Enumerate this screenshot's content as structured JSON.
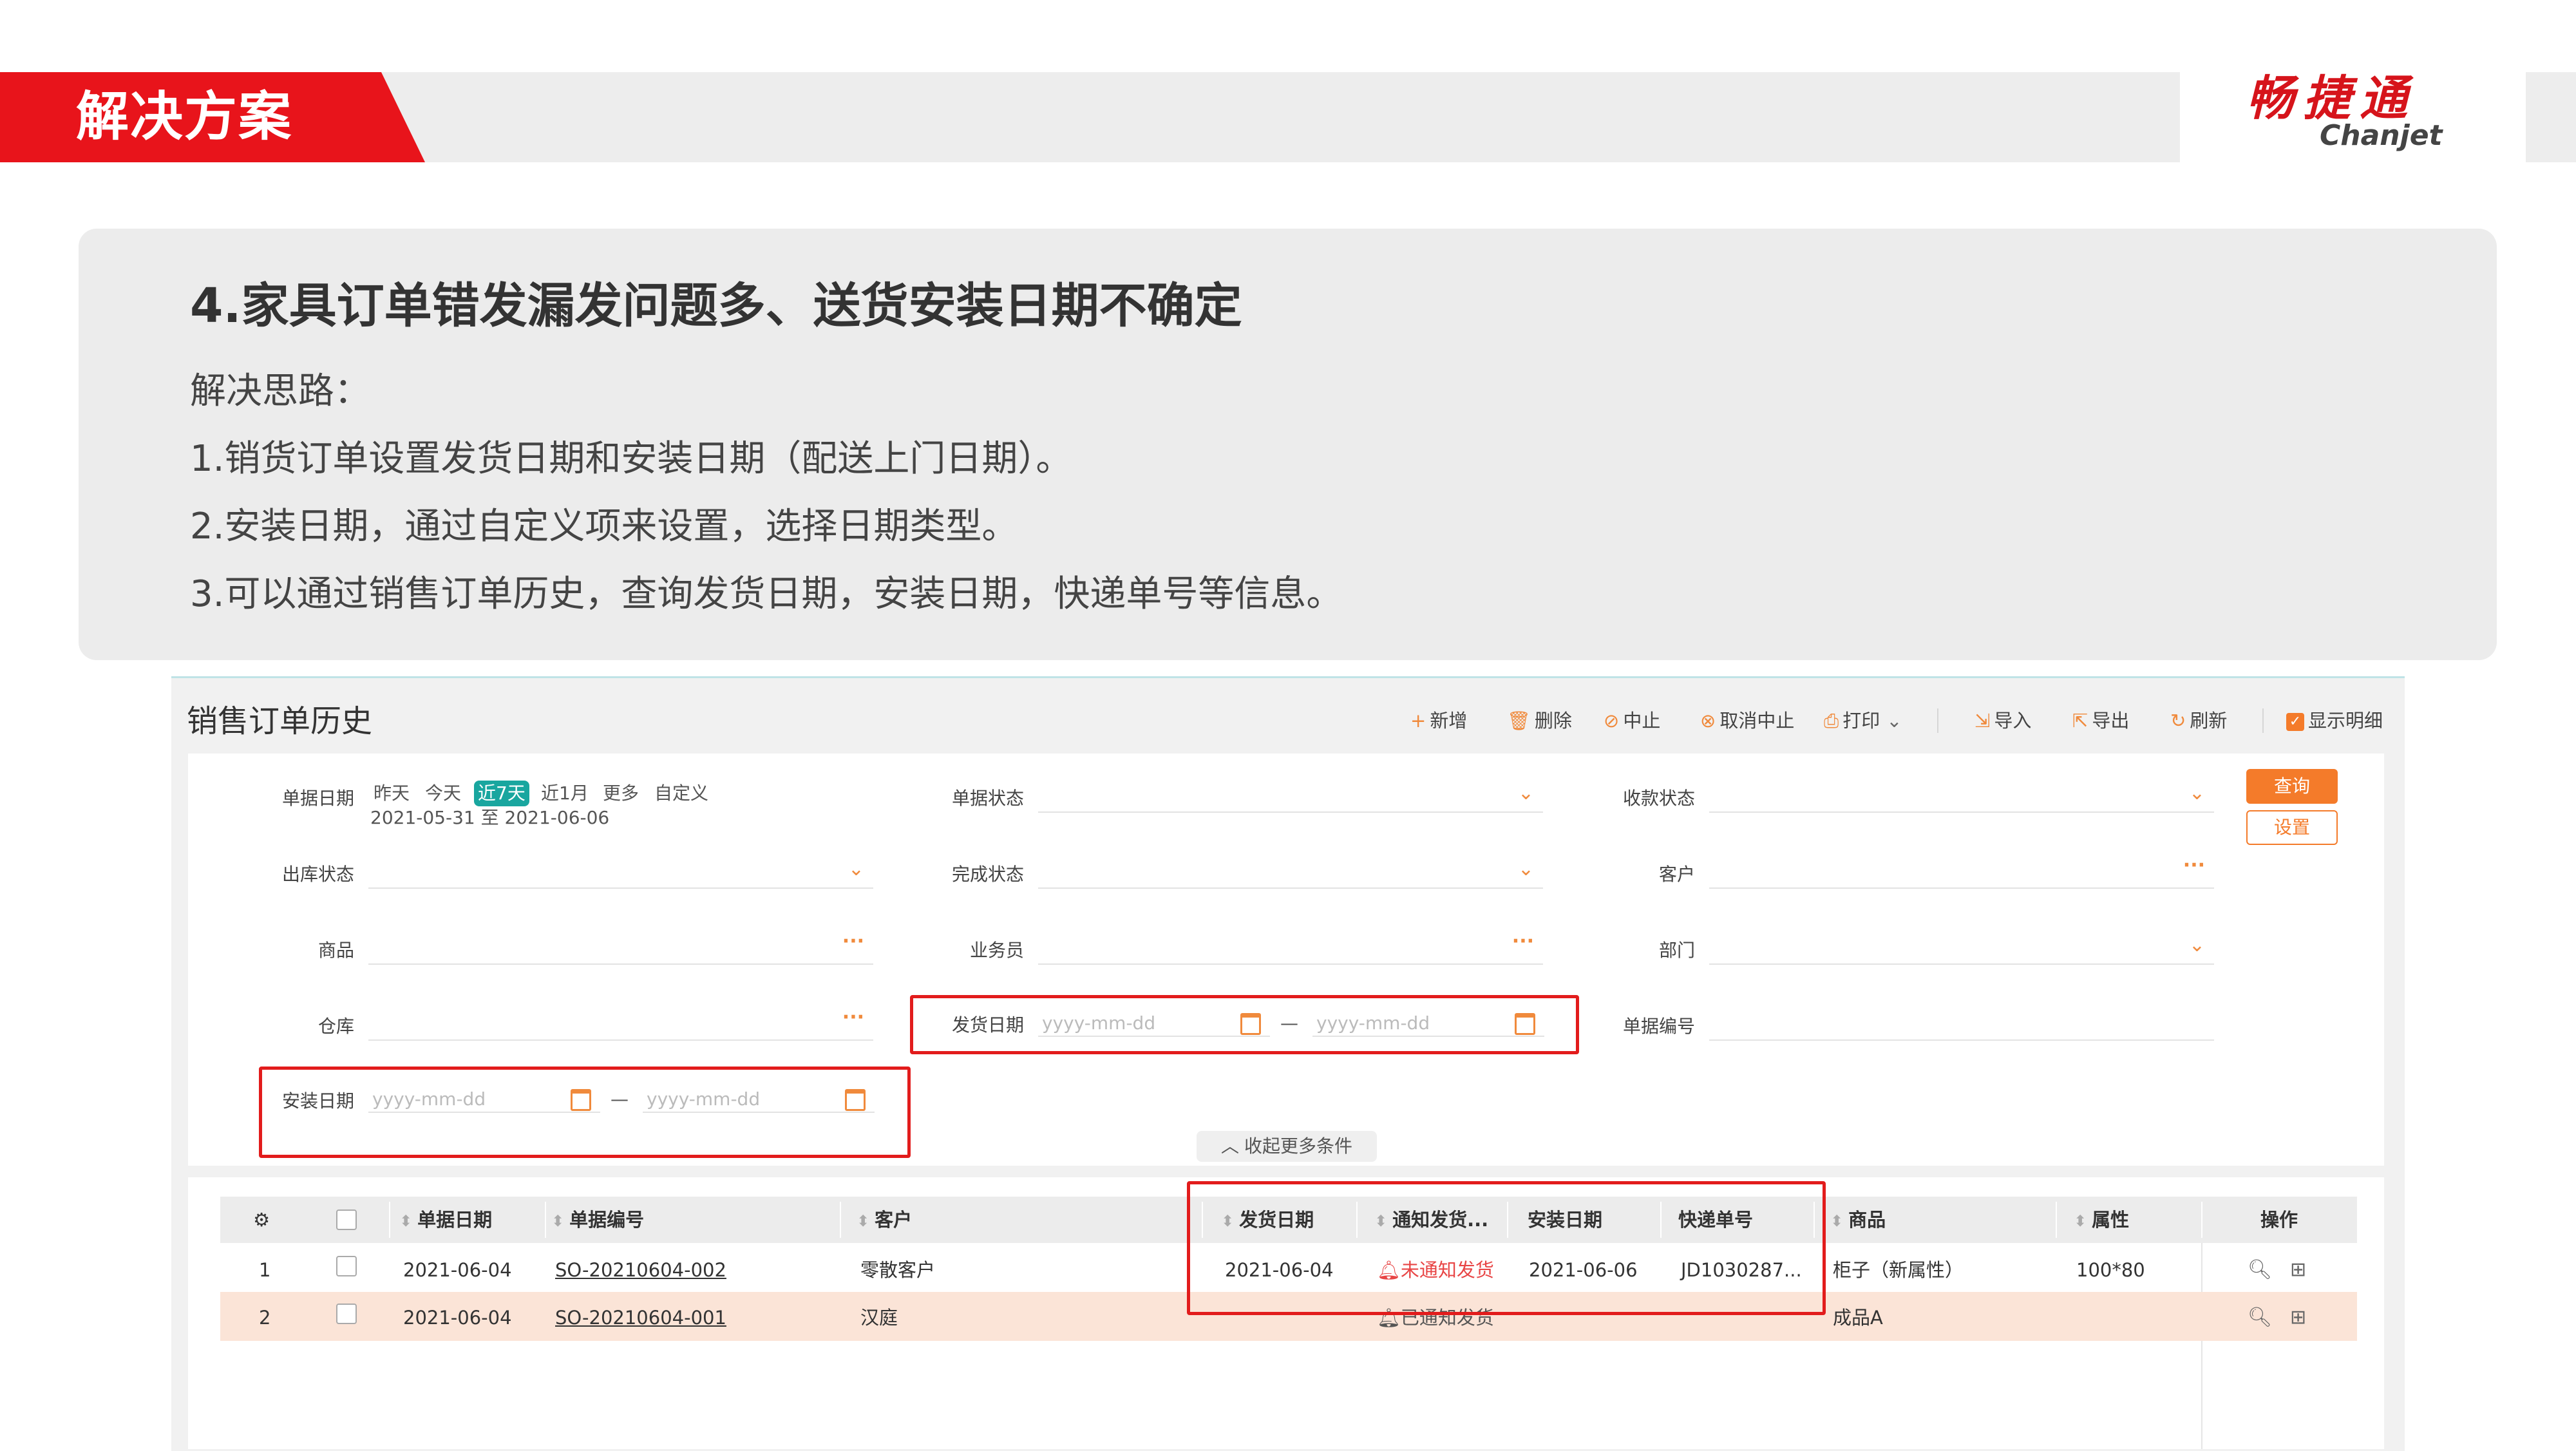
{
  "header": {
    "title": "解决方案",
    "logo_cn": "畅捷通",
    "logo_en": "Chanjet"
  },
  "card": {
    "title": "4.家具订单错发漏发问题多、送货安装日期不确定",
    "lines": [
      "解决思路：",
      "1.销货订单设置发货日期和安装日期（配送上门日期）。",
      "2.安装日期，通过自定义项来设置，选择日期类型。",
      "3.可以通过销售订单历史，查询发货日期，安装日期，快递单号等信息。"
    ]
  },
  "screen": {
    "title": "销售订单历史",
    "toolbar": {
      "add": "新增",
      "delete": "删除",
      "stop": "中止",
      "cancel_stop": "取消中止",
      "print": "打印",
      "import": "导入",
      "export": "导出",
      "refresh": "刷新",
      "show_detail": "显示明细"
    },
    "filters": {
      "doc_date": "单据日期",
      "quick_dates": [
        "昨天",
        "今天",
        "近7天",
        "近1月",
        "更多",
        "自定义"
      ],
      "date_range": "2021-05-31 至 2021-06-06",
      "doc_status": "单据状态",
      "collect_status": "收款状态",
      "outbound_status": "出库状态",
      "complete_status": "完成状态",
      "customer": "客户",
      "product": "商品",
      "salesman": "业务员",
      "department": "部门",
      "warehouse": "仓库",
      "ship_date": "发货日期",
      "doc_no": "单据编号",
      "install_date": "安装日期",
      "date_placeholder": "yyyy-mm-dd",
      "range_sep": "—",
      "query": "查询",
      "settings": "设置",
      "collapse": "收起更多条件"
    },
    "table": {
      "headers": [
        "单据日期",
        "单据编号",
        "客户",
        "发货日期",
        "通知发货...",
        "安装日期",
        "快递单号",
        "商品",
        "属性",
        "操作"
      ],
      "rows": [
        {
          "idx": "1",
          "date": "2021-06-04",
          "no": "SO-20210604-002",
          "customer": "零散客户",
          "ship": "2021-06-04",
          "notify": "未通知发货",
          "install": "2021-06-06",
          "express": "JD1030287...",
          "product": "柜子（新属性）",
          "attr": "100*80"
        },
        {
          "idx": "2",
          "date": "2021-06-04",
          "no": "SO-20210604-001",
          "customer": "汉庭",
          "ship": "",
          "notify": "已通知发货",
          "install": "",
          "express": "",
          "product": "成品A",
          "attr": ""
        }
      ]
    }
  },
  "colors": {
    "brand_red": "#e8141b",
    "accent_orange": "#f47b2a",
    "teal": "#19a69f",
    "highlight_red": "#e21c1c"
  }
}
